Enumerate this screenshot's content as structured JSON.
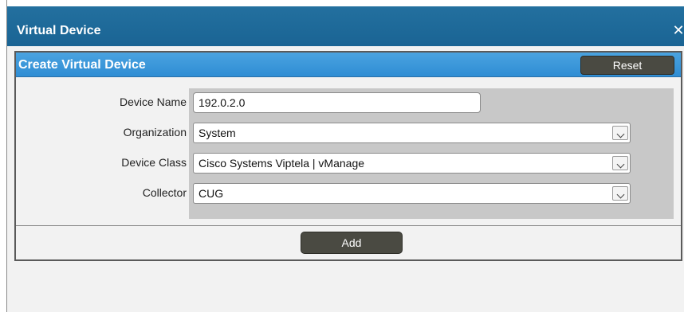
{
  "window": {
    "title": "Virtual Device",
    "close_glyph": "✕"
  },
  "panel": {
    "title": "Create Virtual Device",
    "reset_label": "Reset"
  },
  "form": {
    "device_name": {
      "label": "Device Name",
      "value": "192.0.2.0"
    },
    "organization": {
      "label": "Organization",
      "value": "System"
    },
    "device_class": {
      "label": "Device Class",
      "value": "Cisco Systems Viptela | vManage"
    },
    "collector": {
      "label": "Collector",
      "value": "CUG"
    }
  },
  "footer": {
    "add_label": "Add"
  },
  "colors": {
    "titlebar": "#1b6b9f",
    "panel_header": "#3a97da",
    "button": "#4a4a42"
  },
  "icons": {
    "close": "close-icon",
    "dropdown": "chevron-down-icon"
  }
}
